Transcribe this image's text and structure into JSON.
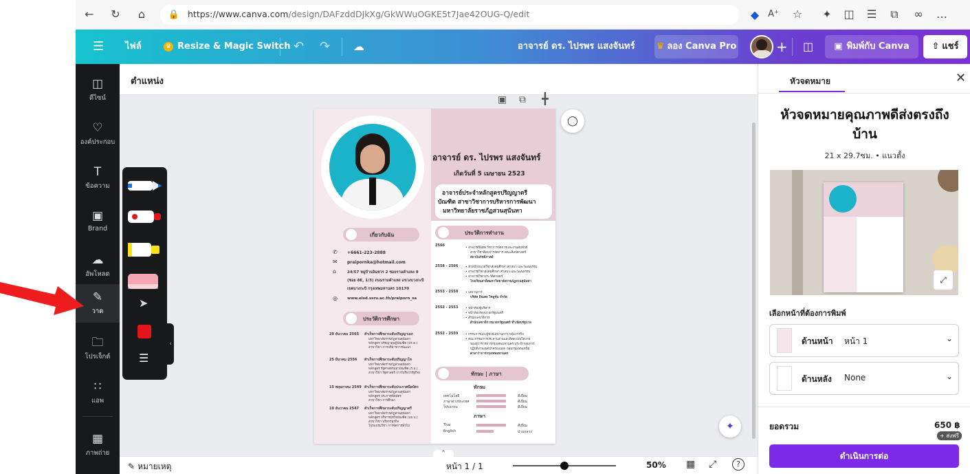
{
  "browser": {
    "url_host": "https://www.canva.com",
    "url_path": "/design/DAFzddDJkXg/GkWWuOGKE5t7Jae42OUG-Q/edit"
  },
  "topbar": {
    "menu_label": "ไฟล์",
    "resize_label": "Resize & Magic Switch",
    "design_title": "อาจารย์ ดร. ไปรพร แสงจันทร์",
    "pro_label": "ลอง Canva Pro",
    "print_label": "พิมพ์กับ Canva",
    "share_label": "แชร์"
  },
  "sidebar": {
    "items": [
      {
        "label": "ดีไซน์",
        "icon": "layout-icon"
      },
      {
        "label": "องค์ประกอบ",
        "icon": "shapes-icon"
      },
      {
        "label": "ข้อความ",
        "icon": "text-icon"
      },
      {
        "label": "Brand",
        "icon": "brand-icon"
      },
      {
        "label": "อัพโหลด",
        "icon": "upload-cloud-icon"
      },
      {
        "label": "วาด",
        "icon": "draw-pen-icon"
      },
      {
        "label": "โปรเจ็กต์",
        "icon": "folder-icon"
      },
      {
        "label": "แอพ",
        "icon": "apps-grid-icon"
      },
      {
        "label": "ภาพถ่าย",
        "icon": "photo-icon"
      }
    ]
  },
  "workspace": {
    "position_label": "ตำแหน่ง",
    "notes_label": "หมายเหตุ",
    "page_indicator": "หน้า 1 / 1",
    "zoom": "50%",
    "zoom_fraction": 0.5
  },
  "resume": {
    "name": "อาจารย์ ดร. ไปรพร แสงจันทร์",
    "birth": "เกิดวันที่ 5 เมษายน 2523",
    "position_lines": [
      "อาจารย์ประจำหลักสูตรปริญญาตรี",
      "บัณฑิต สาขาวิชาการบริหารการพัฒนา",
      "มหาวิทยาลัยราชภัฏสวนสุนันทา"
    ],
    "about_heading": "เกี่ยวกับฉัน",
    "phone": "+6661-223-2888",
    "email": "praipornka@hotmail.com",
    "address_lines": [
      "24/57 หมู่บ้านอินชวร 2 ซอยรามคำแหง 9",
      "(ซอย 8E, 1/3) ถนนรามคำแหง แขวงบางกะปิ",
      "เขตบางกะปิ กรุงเทพมหานคร 10170"
    ],
    "website": "www.eisd.ssru.ac.th/praiporn_sa",
    "education_heading": "ประวัติการศึกษา",
    "education": [
      {
        "date": "29 ธันวาคม 2565",
        "title": "สำเร็จการศึกษาระดับปริญญาเอก",
        "lines": [
          "มหาวิทยาลัยราชภัฏสวนสุนันทา",
          "หลักสูตร ปรัชญาดุษฎีบัณฑิต (ปร.ด.)",
          "สาขาวิชา การบริหารการพัฒนา"
        ]
      },
      {
        "date": "25 มีนาคม 2556",
        "title": "สำเร็จการศึกษาระดับปริญญาโท",
        "lines": [
          "มหาวิทยาลัยราชภัฏสวนสุนันทา",
          "หลักสูตร รัฐศาสตรมหาบัณฑิต (ร.ม.)",
          "สาขาวิชา รัฐศาสตร์ (การบริหารรัฐกิจ)"
        ]
      },
      {
        "date": "15 พฤษภาคม 2549",
        "title": "สำเร็จการศึกษาระดับประกาศนียบัตร",
        "lines": [
          "มหาวิทยาลัยราชภัฏสวนสุนันทา",
          "หลักสูตร ประกาศนียบัตร",
          "สาขาวิชา การศึกษา"
        ]
      },
      {
        "date": "10 ธันวาคม 2547",
        "title": "สำเร็จการศึกษาระดับปริญญาตรี",
        "lines": [
          "มหาวิทยาลัยราชภัฏสวนสุนันทา",
          "หลักสูตร บริหารธุรกิจบัณฑิต (บธ.บ.)",
          "สาขาวิชา บริหารธุรกิจ",
          "โปรแกรมวิชา การจัดการทั่วไป"
        ]
      }
    ],
    "work_heading": "ประวัติการทำงาน",
    "work": [
      {
        "year": "2566",
        "lines": [
          "• อาจารย์พิเศษ วิชาการจัดการและงานสัมพันธ์",
          "สาขาวิชาศิลปการจัดการ คณะศิลปศาสตร์",
          "สถาบันรัชต์ภาคย์"
        ]
      },
      {
        "year": "2558 - 2566",
        "lines": [
          "• หัวหน้าหมวดวิชาสังคมศึกษา ศาสนา และวัฒนธรรม",
          "• อาจารย์วิชาสังคมศึกษา ศาสนา และวัฒนธรรม",
          "• อาจารย์วิชาประวัติศาสตร์",
          "โรงเรียนสาธิตมหาวิทยาลัยราชภัฏสวนสุนันทา"
        ]
      },
      {
        "year": "2553 - 2558",
        "lines": [
          "• เลขานุการ",
          "บริษัท อินเตอ ไซลูชั่น จำกัด"
        ]
      },
      {
        "year": "2552 - 2553",
        "lines": [
          "• หน้าห้องผู้บริหาร",
          "• หน้าห้องรองนายกรัฐมนตรี",
          "• สำนักเลขาธิการ",
          "สำนักเลขาธิการนายกรัฐมนตรี ทำเนียบรัฐบาล"
        ]
      },
      {
        "year": "2552 - 2559",
        "lines": [
          "• กรรมการและผู้ช่วยเลขานุการ กลุ่มภารกิจ",
          "• คณะกรรมการประสานงานและติดตามนโยบาย",
          "ของผู้ว่าราชการกรุงเทพมหานคร ประจำกลุ่มการ",
          "ปฏิบัติงานเขตปกครองนอก กลุ่มกรุงเทพเหนือ",
          "ศาลาว่าการกรุงเทพมหานคร"
        ]
      }
    ],
    "skills_heading": "ทักษะ | ภาษา",
    "skills_sub": "ทักษะ",
    "skills": [
      {
        "name": "เทคโนโลยี",
        "level": "ดีเยี่ยม",
        "fraction": 0.85
      },
      {
        "name": "ภาษาต่างประเทศ",
        "level": "ดีเยี่ยม",
        "fraction": 0.85
      },
      {
        "name": "โปรแกรม",
        "level": "ดีเยี่ยม",
        "fraction": 0.85
      }
    ],
    "lang_sub": "ภาษา",
    "languages": [
      {
        "name": "Thai",
        "level": "ดีเยี่ยม",
        "fraction": 0.85
      },
      {
        "name": "English",
        "level": "ปานกลาง",
        "fraction": 0.5
      }
    ]
  },
  "draw_panel": {
    "tools": [
      "pen-tool-icon",
      "marker-tool-icon",
      "highlighter-tool-icon",
      "eraser-tool-icon",
      "select-arrow-icon"
    ],
    "colors": {
      "pen": "#1a73e8",
      "marker": "#e3141b",
      "highlighter": "#f7e318",
      "eraser": "#f4a6b3",
      "swatch": "#e3141b"
    }
  },
  "right_panel": {
    "tab_label": "หัวจดหมาย",
    "title": "หัวจดหมายคุณภาพดีส่งตรงถึงบ้าน",
    "spec": "21 x 29.7ซม. • แนวตั้ง",
    "choose_label": "เลือกหน้าที่ต้องการพิมพ์",
    "front_label": "ด้านหน้า",
    "front_value": "หน้า 1",
    "back_label": "ด้านหลัง",
    "back_value": "None",
    "total_label": "ยอดรวม",
    "price": "650 ฿",
    "free_shipping": "+ ส่งฟรี",
    "continue_label": "ดำเนินการต่อ"
  },
  "colors": {
    "pink": "#e5c5cf",
    "pink_dark": "#c9a3b1",
    "purple": "#7d2ae8",
    "sidebar": "#18191b"
  }
}
